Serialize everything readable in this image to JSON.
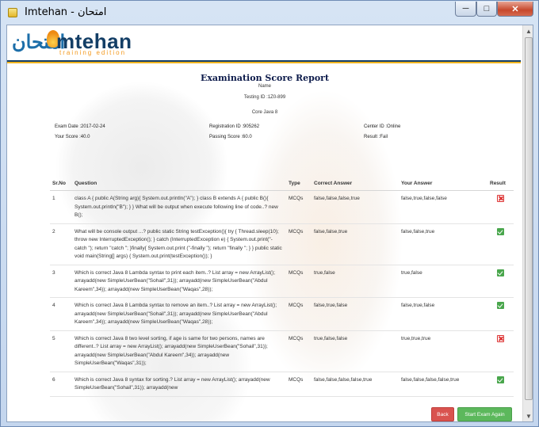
{
  "window": {
    "title": "Imtehan - امتحان"
  },
  "logo": {
    "arabic": "امتحان",
    "english": "mtehan",
    "subtitle": "training edition"
  },
  "report": {
    "title": "Examination Score Report",
    "name_label": "Name",
    "testing_id": "Testing ID :1Z0-899",
    "exam_name": "Core Java 8",
    "exam_date": "Exam Date :2017-02-24",
    "registration_id": "Registration ID :905262",
    "center_id": "Center ID :Online",
    "your_score": "Your Score :40.0",
    "passing_score": "Passing Score :60.0",
    "result": "Result :Fail"
  },
  "table": {
    "headers": {
      "sr": "Sr.No",
      "question": "Question",
      "type": "Type",
      "correct": "Correct Answer",
      "yours": "Your Answer",
      "result": "Result"
    },
    "rows": [
      {
        "sr": "1",
        "question": "class A { public A(String arg){ System.out.println(\"A\"); } class B extends A { public B(){ System.out.println(\"B\"); } } What will be output when execute following line of code..? new B();",
        "type": "MCQs",
        "correct": "false,false,false,true",
        "yours": "false,true,false,false",
        "status": "fail"
      },
      {
        "sr": "2",
        "question": "What will be console output ...? public static String testException(){ try { Thread.sleep(10); throw new InterruptedException(); } catch (InterruptedException e) { System.out.print(\"-catch \"); return \"catch \"; }finally{ System.out.print (\"-finally \"); return \"finally \"; } } public static void main(String[] args) { System.out.print(testException()); }",
        "type": "MCQs",
        "correct": "false,false,true",
        "yours": "false,false,true",
        "status": "pass"
      },
      {
        "sr": "3",
        "question": "Which is correct Java 8 Lambda syntax to print each item..? List array = new ArrayList(); arrayadd(new SimpleUserBean(\"Sohail\",31)); arrayadd(new SimpleUserBean(\"Abdul Kareem\",34)); arrayadd(new SimpleUserBean(\"Waqas\",28));",
        "type": "MCQs",
        "correct": "true,false",
        "yours": "true,false",
        "status": "pass"
      },
      {
        "sr": "4",
        "question": "Which is correct Java 8 Lambda syntax to remove an item..? List array = new ArrayList(); arrayadd(new SimpleUserBean(\"Sohail\",31)); arrayadd(new SimpleUserBean(\"Abdul Kareem\",34)); arrayadd(new SimpleUserBean(\"Waqas\",28));",
        "type": "MCQs",
        "correct": "false,true,false",
        "yours": "false,true,false",
        "status": "pass"
      },
      {
        "sr": "5",
        "question": "Which is correct Java 8 two level sorting, if age is same for two persons, names are different..? List array = new ArrayList(); arrayadd(new SimpleUserBean(\"Sohail\",31)); arrayadd(new SimpleUserBean(\"Abdul Kareem\",34)); arrayadd(new SimpleUserBean(\"Waqas\",31));",
        "type": "MCQs",
        "correct": "true,false,false",
        "yours": "true,true,true",
        "status": "fail"
      },
      {
        "sr": "6",
        "question": "Which is correct Java 8 syntax for sorting.? List array = new ArrayList(); arrayadd(new SimpleUserBean(\"Sohail\",31)); arrayadd(new",
        "type": "MCQs",
        "correct": "false,false,false,false,true",
        "yours": "false,false,false,false,true",
        "status": "pass"
      }
    ]
  },
  "buttons": {
    "back": "Back",
    "start_again": "Start Exam Again"
  },
  "colors": {
    "back": "#d9534f",
    "start_again": "#5cb85c",
    "brand_navy": "#133e66",
    "brand_orange": "#f39a20"
  }
}
